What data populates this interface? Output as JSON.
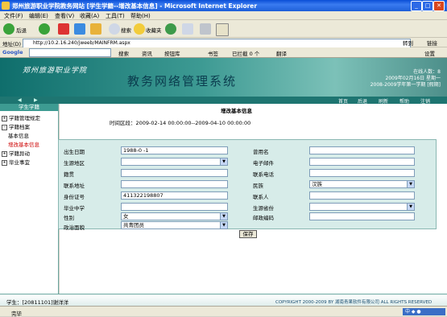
{
  "window": {
    "title": "郑州旅游职业学院教务网站 [学生学籍--增改基本信息] - Microsoft Internet Explorer"
  },
  "menu": [
    "文件(F)",
    "编辑(E)",
    "查看(V)",
    "收藏(A)",
    "工具(T)",
    "帮助(H)"
  ],
  "toolbar": {
    "back": "后退",
    "search": "搜索",
    "favorites": "收藏夹"
  },
  "address": {
    "label": "地址(D)",
    "url": "http://10.2.16.240/jweeb/MAINFRM.aspx",
    "go": "转到",
    "links": "链接"
  },
  "googlebar": {
    "brand": "Google",
    "search": "搜索",
    "news": "资讯",
    "tools": "按钮库",
    "bookmarks": "书签",
    "popups": "已拦截 0 个",
    "translate": "翻译",
    "settings": "设置"
  },
  "banner": {
    "school": "郑州旅游职业学院",
    "system": "教务网络管理系统",
    "online": "在线人数：8",
    "date": "2009年02月16日 星期一",
    "term": "2008-2009学年第一学期 [假期]"
  },
  "nav": [
    "首页",
    "后退",
    "刷新",
    "帮助",
    "注销"
  ],
  "sidebar": {
    "head": "学生学籍",
    "items": [
      "学籍管理规定",
      "学籍档案",
      "基本信息",
      "增改基本信息",
      "学籍异动",
      "毕业事宜"
    ]
  },
  "main": {
    "title": "增改基本信息",
    "time_range": "时间区段：2009-02-14 00:00:00--2009-04-10 00:00:00"
  },
  "form": {
    "left": [
      {
        "label": "出生日期",
        "value": "1988-0 -1"
      },
      {
        "label": "生源地区",
        "value": ""
      },
      {
        "label": "籍贯",
        "value": ""
      },
      {
        "label": "联系地址",
        "value": ""
      },
      {
        "label": "身份证号",
        "value": "411322198807"
      },
      {
        "label": "毕业中学",
        "value": ""
      },
      {
        "label": "性别",
        "value": "女"
      },
      {
        "label": "政治面貌",
        "value": "共青团员"
      }
    ],
    "right": [
      {
        "label": "曾用名",
        "value": ""
      },
      {
        "label": "电子邮件",
        "value": ""
      },
      {
        "label": "联系电话",
        "value": ""
      },
      {
        "label": "民族",
        "value": "汉族"
      },
      {
        "label": "联系人",
        "value": ""
      },
      {
        "label": "生源省份",
        "value": ""
      },
      {
        "label": "邮政编码",
        "value": ""
      }
    ],
    "save": "保存"
  },
  "footer": {
    "student": "学生：[20811101]谢洋洋",
    "copyright": "COPYRIGHT 2000-2009 BY 湖南青果软件有限公司 ALL RIGHTS RESERVED"
  },
  "statusbar": {
    "text": "完毕"
  }
}
